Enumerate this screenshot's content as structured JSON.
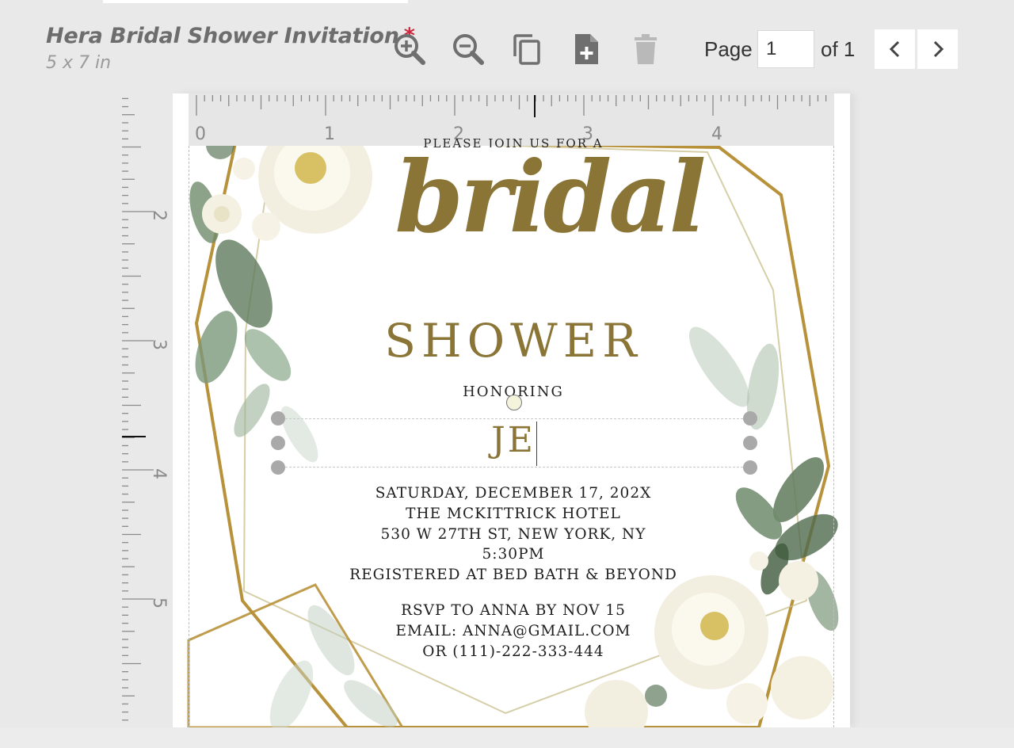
{
  "header": {
    "title": "Hera Bridal Shower Invitation",
    "modified_marker": "*",
    "size": "5 x 7 in"
  },
  "toolbar": {
    "zoom_in_icon": "zoom-in-icon",
    "zoom_out_icon": "zoom-out-icon",
    "duplicate_icon": "duplicate-icon",
    "add_page_icon": "add-page-icon",
    "delete_icon": "trash-icon"
  },
  "pager": {
    "page_label": "Page",
    "current_page": "1",
    "of_label": "of 1",
    "prev_icon": "chevron-left-icon",
    "next_icon": "chevron-right-icon"
  },
  "rulers": {
    "horizontal_labels": [
      "0",
      "1",
      "2",
      "3",
      "4"
    ],
    "vertical_labels": [
      "2",
      "3",
      "4",
      "5"
    ]
  },
  "invitation": {
    "cut_top_line": "PLEASE JOIN US FOR A",
    "script_title": "bridal",
    "subtitle": "SHOWER",
    "honoring": "HONORING",
    "name_text": "JE",
    "details": [
      "SATURDAY, DECEMBER 17, 202X",
      "THE MCKITTRICK HOTEL",
      "530 W 27TH ST, NEW YORK, NY",
      "5:30PM",
      "REGISTERED AT BED BATH & BEYOND"
    ],
    "rsvp": [
      "RSVP TO ANNA BY NOV 15",
      "EMAIL: ANNA@GMAIL.COM",
      "OR (111)-222-333-444"
    ]
  },
  "colors": {
    "gold": "#8a7536",
    "frame_gold": "#b8923a",
    "leaf_green": "#5f7a5c",
    "asterisk": "#d0263d"
  }
}
